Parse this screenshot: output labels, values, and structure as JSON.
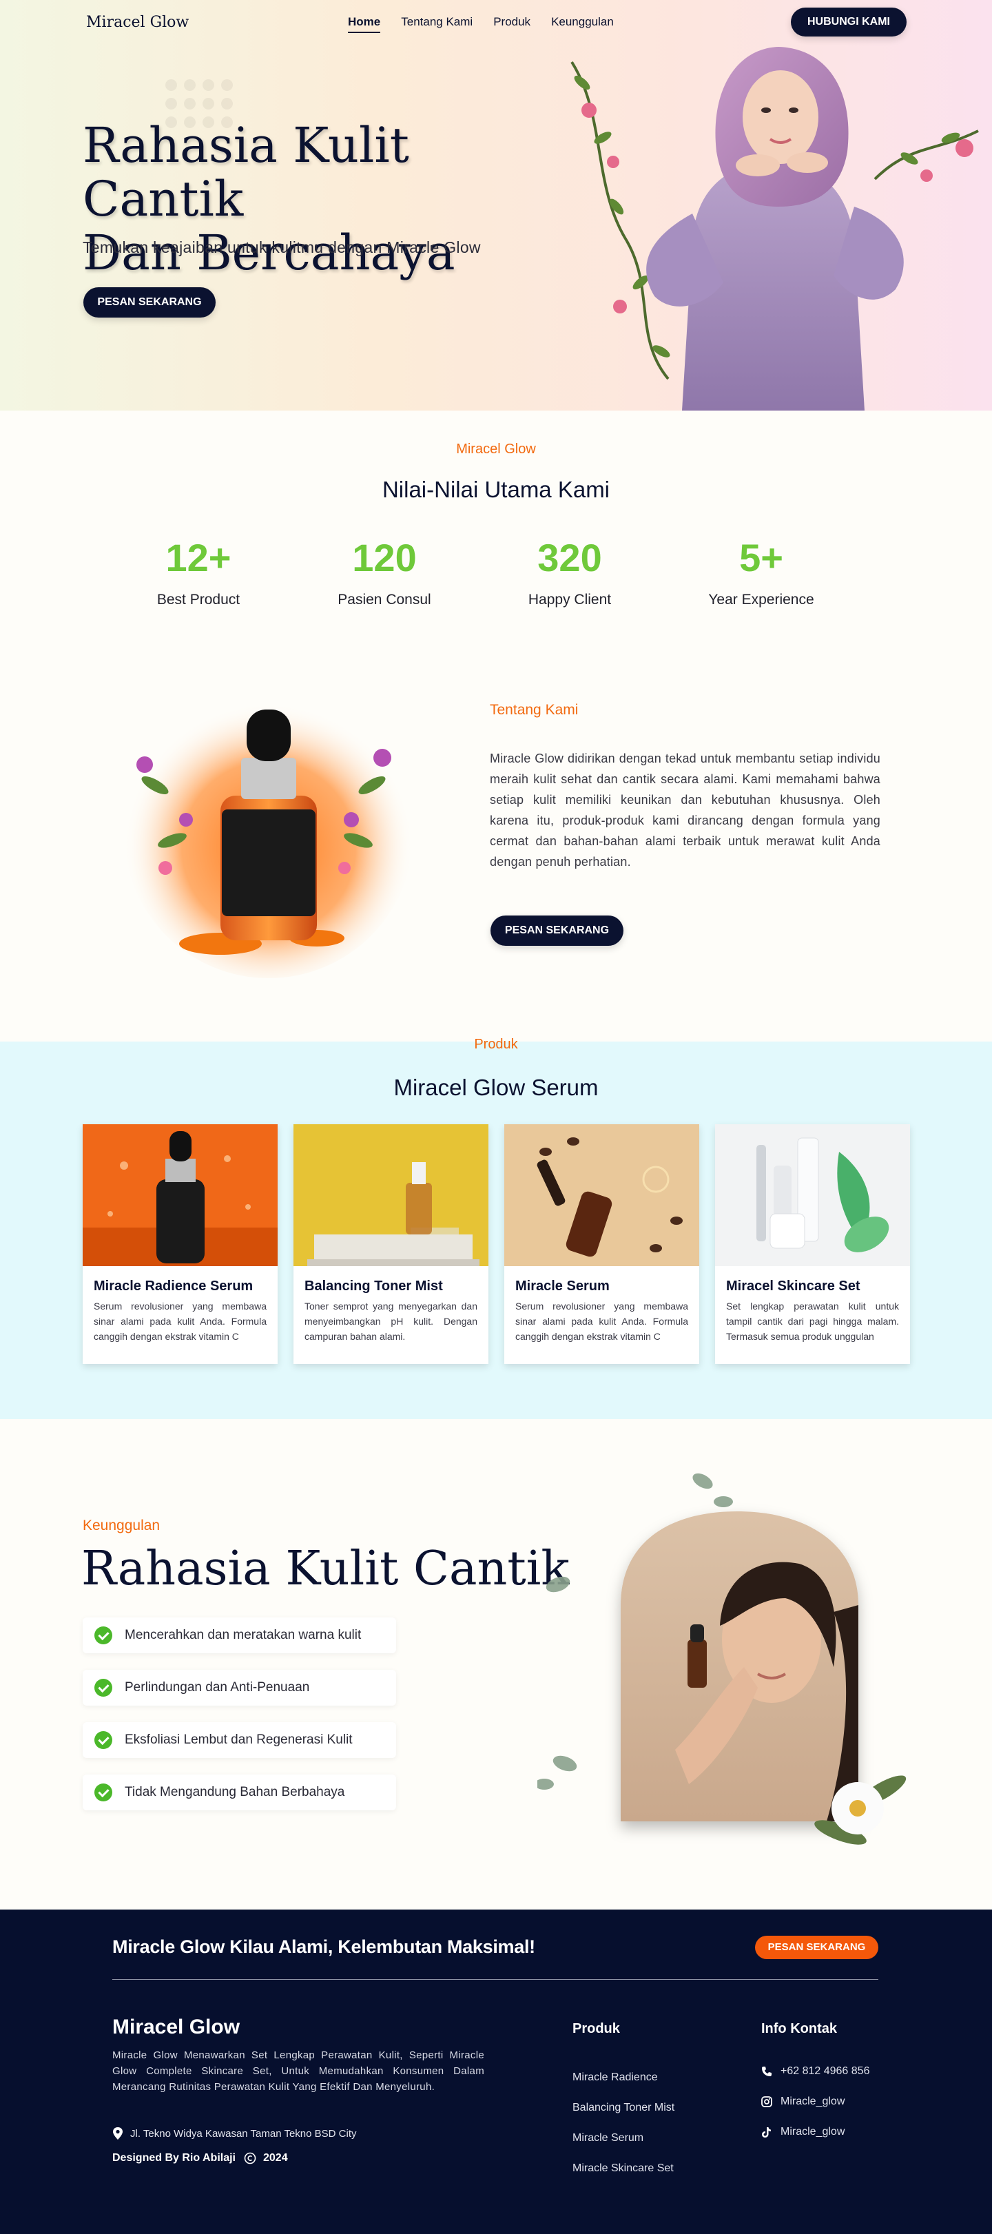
{
  "nav": {
    "logo": "Miracel Glow",
    "links": [
      "Home",
      "Tentang Kami",
      "Produk",
      "Keunggulan"
    ],
    "cta": "HUBUNGI KAMI"
  },
  "hero": {
    "title_line1": "Rahasia Kulit Cantik",
    "title_line2": "Dan Bercahaya",
    "subtitle": "Temukan keajaiban untuk kulitmu dengan Miracle Glow",
    "cta": "PESAN SEKARANG"
  },
  "values": {
    "eyebrow": "Miracel Glow",
    "title": "Nilai-Nilai Utama Kami",
    "stats": [
      {
        "num": "12+",
        "label": "Best Product"
      },
      {
        "num": "120",
        "label": "Pasien Consul"
      },
      {
        "num": "320",
        "label": "Happy Client"
      },
      {
        "num": "5+",
        "label": "Year Experience"
      }
    ],
    "accent": "#6fc93a"
  },
  "about": {
    "eyebrow": "Tentang Kami",
    "text": "Miracle Glow didirikan dengan tekad untuk membantu setiap individu meraih kulit sehat dan cantik secara alami. Kami memahami bahwa setiap kulit memiliki keunikan dan kebutuhan khususnya. Oleh karena itu, produk-produk kami dirancang dengan formula yang cermat dan bahan-bahan alami terbaik untuk merawat kulit Anda dengan penuh perhatian.",
    "cta": "PESAN SEKARANG"
  },
  "products": {
    "eyebrow": "Produk",
    "title": "Miracel Glow Serum",
    "items": [
      {
        "name": "Miracle Radience Serum",
        "desc": "Serum revolusioner yang membawa sinar alami pada kulit Anda. Formula canggih dengan ekstrak vitamin C"
      },
      {
        "name": "Balancing Toner Mist",
        "desc": "Toner semprot yang menyegarkan dan menyeimbangkan pH kulit. Dengan campuran bahan alami."
      },
      {
        "name": "Miracle Serum",
        "desc": "Serum revolusioner yang membawa sinar alami pada kulit Anda. Formula canggih dengan ekstrak vitamin C"
      },
      {
        "name": "Miracel Skincare Set",
        "desc": "Set lengkap perawatan kulit untuk tampil cantik dari pagi hingga malam. Termasuk semua produk unggulan"
      }
    ]
  },
  "advantages": {
    "eyebrow": "Keunggulan",
    "title": "Rahasia Kulit Cantik",
    "items": [
      "Mencerahkan dan meratakan warna kulit",
      "Perlindungan dan Anti-Penuaan",
      "Eksfoliasi Lembut dan Regenerasi Kulit",
      "Tidak Mengandung Bahan Berbahaya"
    ]
  },
  "footer": {
    "cta_text": "Miracle Glow Kilau Alami, Kelembutan Maksimal!",
    "cta_button": "PESAN SEKARANG",
    "brand": "Miracel Glow",
    "description": "Miracle Glow Menawarkan Set Lengkap Perawatan Kulit, Seperti Miracle Glow Complete Skincare Set, Untuk Memudahkan Konsumen Dalam Merancang Rutinitas Perawatan Kulit Yang Efektif Dan Menyeluruh.",
    "address": "Jl. Tekno Widya Kawasan Taman Tekno BSD City",
    "credit": "Designed By Rio Abilaji",
    "year": "2024",
    "products_heading": "Produk",
    "products_links": [
      "Miracle Radience",
      "Balancing Toner Mist",
      "Miracle Serum",
      "Miracle Skincare Set"
    ],
    "contact_heading": "Info Kontak",
    "phone": "+62 812 4966 856",
    "instagram": "Miracle_glow",
    "tiktok": "Miracle_glow"
  },
  "colors": {
    "navy": "#0b1230",
    "orange": "#f26a10",
    "green": "#6fc93a",
    "footer_bg": "#060f2e",
    "products_bg": "#e2f9fc"
  }
}
